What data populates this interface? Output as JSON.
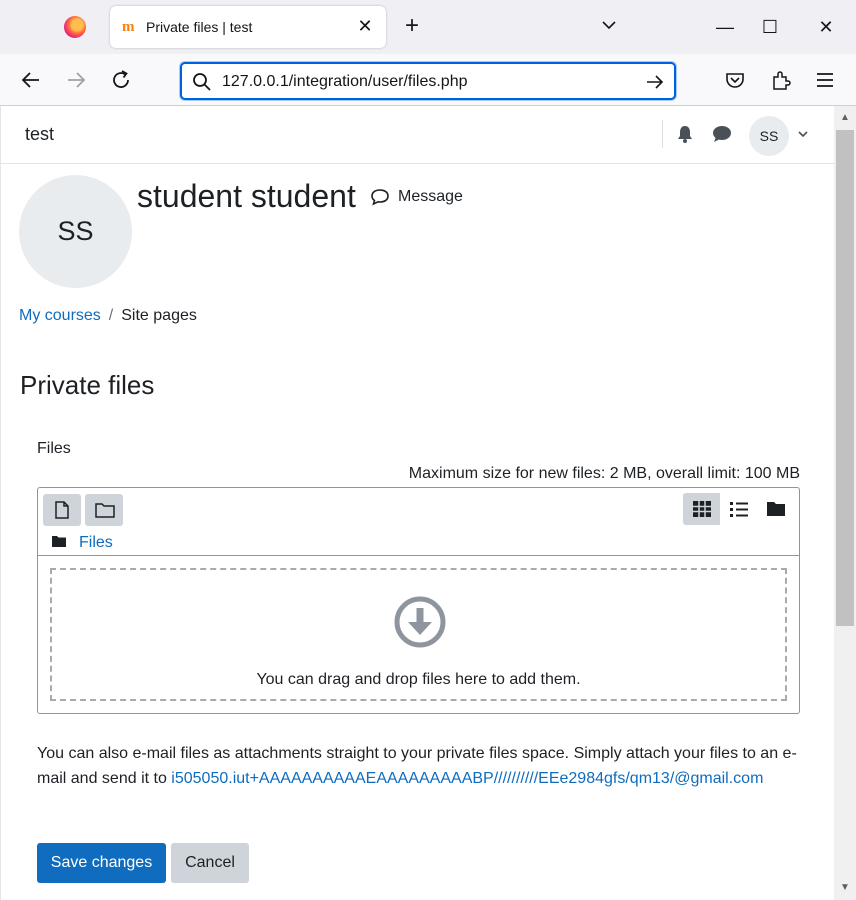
{
  "browser": {
    "tab_title": "Private files | test",
    "tab_favicon": "m",
    "url": "127.0.0.1/integration/user/files.php",
    "new_tab_label": "+",
    "minimize_label": "—",
    "maximize_label": "☐",
    "close_label": "✕"
  },
  "site": {
    "name": "test",
    "user_initials": "SS"
  },
  "profile": {
    "initials": "SS",
    "full_name": "student student",
    "message_label": "Message"
  },
  "breadcrumb": {
    "items": [
      "My courses",
      "Site pages"
    ],
    "separator": "/"
  },
  "main": {
    "title": "Private files",
    "files_label": "Files",
    "max_size": "Maximum size for new files: 2 MB, overall limit: 100 MB",
    "path_label": "Files",
    "drop_text": "You can drag and drop files here to add them.",
    "email_text": "You can also e-mail files as attachments straight to your private files space. Simply attach your files to an e-mail and send it to ",
    "email_address": "i505050.iut+AAAAAAAAAAEAAAAAAAAABP//////////EEe2984gfs/qm13/@gmail.com"
  },
  "actions": {
    "save_label": "Save changes",
    "cancel_label": "Cancel"
  },
  "colors": {
    "link": "#0f6cbf",
    "primary_button": "#0f6cbf",
    "secondary_button": "#ced4da"
  }
}
